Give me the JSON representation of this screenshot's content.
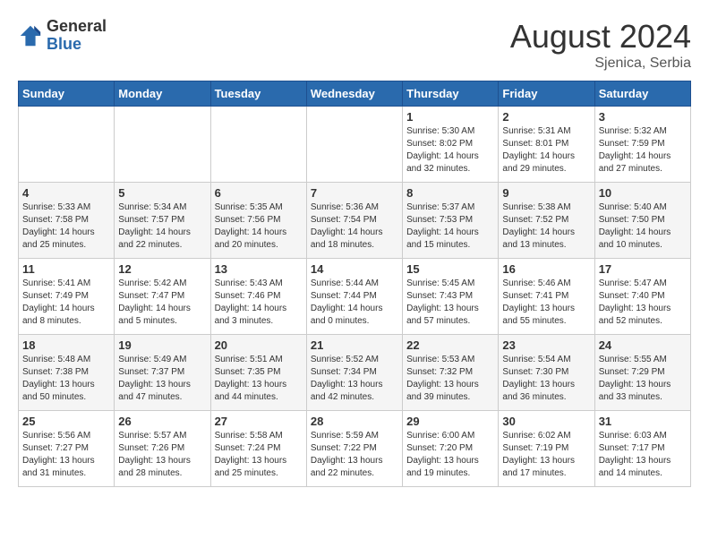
{
  "header": {
    "logo_general": "General",
    "logo_blue": "Blue",
    "title": "August 2024",
    "location": "Sjenica, Serbia"
  },
  "days_of_week": [
    "Sunday",
    "Monday",
    "Tuesday",
    "Wednesday",
    "Thursday",
    "Friday",
    "Saturday"
  ],
  "weeks": [
    [
      {
        "day": "",
        "content": ""
      },
      {
        "day": "",
        "content": ""
      },
      {
        "day": "",
        "content": ""
      },
      {
        "day": "",
        "content": ""
      },
      {
        "day": "1",
        "content": "Sunrise: 5:30 AM\nSunset: 8:02 PM\nDaylight: 14 hours\nand 32 minutes."
      },
      {
        "day": "2",
        "content": "Sunrise: 5:31 AM\nSunset: 8:01 PM\nDaylight: 14 hours\nand 29 minutes."
      },
      {
        "day": "3",
        "content": "Sunrise: 5:32 AM\nSunset: 7:59 PM\nDaylight: 14 hours\nand 27 minutes."
      }
    ],
    [
      {
        "day": "4",
        "content": "Sunrise: 5:33 AM\nSunset: 7:58 PM\nDaylight: 14 hours\nand 25 minutes."
      },
      {
        "day": "5",
        "content": "Sunrise: 5:34 AM\nSunset: 7:57 PM\nDaylight: 14 hours\nand 22 minutes."
      },
      {
        "day": "6",
        "content": "Sunrise: 5:35 AM\nSunset: 7:56 PM\nDaylight: 14 hours\nand 20 minutes."
      },
      {
        "day": "7",
        "content": "Sunrise: 5:36 AM\nSunset: 7:54 PM\nDaylight: 14 hours\nand 18 minutes."
      },
      {
        "day": "8",
        "content": "Sunrise: 5:37 AM\nSunset: 7:53 PM\nDaylight: 14 hours\nand 15 minutes."
      },
      {
        "day": "9",
        "content": "Sunrise: 5:38 AM\nSunset: 7:52 PM\nDaylight: 14 hours\nand 13 minutes."
      },
      {
        "day": "10",
        "content": "Sunrise: 5:40 AM\nSunset: 7:50 PM\nDaylight: 14 hours\nand 10 minutes."
      }
    ],
    [
      {
        "day": "11",
        "content": "Sunrise: 5:41 AM\nSunset: 7:49 PM\nDaylight: 14 hours\nand 8 minutes."
      },
      {
        "day": "12",
        "content": "Sunrise: 5:42 AM\nSunset: 7:47 PM\nDaylight: 14 hours\nand 5 minutes."
      },
      {
        "day": "13",
        "content": "Sunrise: 5:43 AM\nSunset: 7:46 PM\nDaylight: 14 hours\nand 3 minutes."
      },
      {
        "day": "14",
        "content": "Sunrise: 5:44 AM\nSunset: 7:44 PM\nDaylight: 14 hours\nand 0 minutes."
      },
      {
        "day": "15",
        "content": "Sunrise: 5:45 AM\nSunset: 7:43 PM\nDaylight: 13 hours\nand 57 minutes."
      },
      {
        "day": "16",
        "content": "Sunrise: 5:46 AM\nSunset: 7:41 PM\nDaylight: 13 hours\nand 55 minutes."
      },
      {
        "day": "17",
        "content": "Sunrise: 5:47 AM\nSunset: 7:40 PM\nDaylight: 13 hours\nand 52 minutes."
      }
    ],
    [
      {
        "day": "18",
        "content": "Sunrise: 5:48 AM\nSunset: 7:38 PM\nDaylight: 13 hours\nand 50 minutes."
      },
      {
        "day": "19",
        "content": "Sunrise: 5:49 AM\nSunset: 7:37 PM\nDaylight: 13 hours\nand 47 minutes."
      },
      {
        "day": "20",
        "content": "Sunrise: 5:51 AM\nSunset: 7:35 PM\nDaylight: 13 hours\nand 44 minutes."
      },
      {
        "day": "21",
        "content": "Sunrise: 5:52 AM\nSunset: 7:34 PM\nDaylight: 13 hours\nand 42 minutes."
      },
      {
        "day": "22",
        "content": "Sunrise: 5:53 AM\nSunset: 7:32 PM\nDaylight: 13 hours\nand 39 minutes."
      },
      {
        "day": "23",
        "content": "Sunrise: 5:54 AM\nSunset: 7:30 PM\nDaylight: 13 hours\nand 36 minutes."
      },
      {
        "day": "24",
        "content": "Sunrise: 5:55 AM\nSunset: 7:29 PM\nDaylight: 13 hours\nand 33 minutes."
      }
    ],
    [
      {
        "day": "25",
        "content": "Sunrise: 5:56 AM\nSunset: 7:27 PM\nDaylight: 13 hours\nand 31 minutes."
      },
      {
        "day": "26",
        "content": "Sunrise: 5:57 AM\nSunset: 7:26 PM\nDaylight: 13 hours\nand 28 minutes."
      },
      {
        "day": "27",
        "content": "Sunrise: 5:58 AM\nSunset: 7:24 PM\nDaylight: 13 hours\nand 25 minutes."
      },
      {
        "day": "28",
        "content": "Sunrise: 5:59 AM\nSunset: 7:22 PM\nDaylight: 13 hours\nand 22 minutes."
      },
      {
        "day": "29",
        "content": "Sunrise: 6:00 AM\nSunset: 7:20 PM\nDaylight: 13 hours\nand 19 minutes."
      },
      {
        "day": "30",
        "content": "Sunrise: 6:02 AM\nSunset: 7:19 PM\nDaylight: 13 hours\nand 17 minutes."
      },
      {
        "day": "31",
        "content": "Sunrise: 6:03 AM\nSunset: 7:17 PM\nDaylight: 13 hours\nand 14 minutes."
      }
    ]
  ]
}
